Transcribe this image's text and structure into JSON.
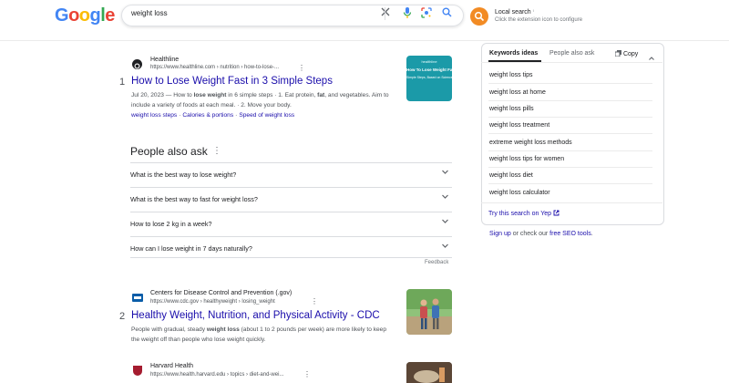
{
  "header": {
    "logo": [
      "G",
      "o",
      "o",
      "g",
      "l",
      "e"
    ],
    "logo_colors": [
      "#4285f4",
      "#ea4335",
      "#fbbc05",
      "#4285f4",
      "#34a853",
      "#ea4335"
    ],
    "search_value": "weight loss",
    "icons": [
      "close-icon",
      "microphone-icon",
      "lens-icon",
      "search-icon"
    ]
  },
  "extension": {
    "title": "Local search",
    "subtitle": "Click the extension icon to configure",
    "accent": "#f28b24"
  },
  "results": [
    {
      "number": "1",
      "site": "Healthline",
      "url": "https://www.healthline.com › nutrition › how-to-lose-...",
      "title": "How to Lose Weight Fast in 3 Simple Steps",
      "date": "Jul 20, 2023",
      "snippet_parts": [
        " — How to ",
        "lose weight",
        " in 6 simple steps · 1. Eat protein, ",
        "fat",
        ", and vegetables. Aim to include a variety of foods at each meal. · 2. Move your body."
      ],
      "sitelinks": [
        "weight loss steps",
        "Calories & portions",
        "Speed of weight loss"
      ],
      "thumb_title": "How To Lose Weight Fast",
      "thumb_sub": "Simple Steps, Based on Science",
      "thumb_brand": "healthline"
    },
    {
      "number": "2",
      "site": "Centers for Disease Control and Prevention (.gov)",
      "url": "https://www.cdc.gov › healthyweight › losing_weight",
      "title": "Healthy Weight, Nutrition, and Physical Activity - CDC",
      "snippet_parts": [
        "People with gradual, steady ",
        "weight loss",
        " (about 1 to 2 pounds per week) are more likely to keep the weight off than people who lose weight quickly."
      ]
    },
    {
      "site": "Harvard Health",
      "url": "https://www.health.harvard.edu › topics › diet-and-wei..."
    }
  ],
  "paa": {
    "heading": "People also ask",
    "questions": [
      "What is the best way to lose weight?",
      "What is the best way to fast for weight loss?",
      "How to lose 2 kg in a week?",
      "How can I lose weight in 7 days naturally?"
    ],
    "feedback": "Feedback"
  },
  "panel": {
    "tabs": [
      "Keywords ideas",
      "People also ask"
    ],
    "copy_label": "Copy",
    "keywords": [
      "weight loss tips",
      "weight loss at home",
      "weight loss pills",
      "weight loss treatment",
      "extreme weight loss methods",
      "weight loss tips for women",
      "weight loss diet",
      "weight loss calculator"
    ],
    "try_yep": "Try this search on Yep",
    "signup_link": "Sign up",
    "signup_middle": " or check our ",
    "seo_link": "free SEO tools",
    "signup_end": "."
  }
}
